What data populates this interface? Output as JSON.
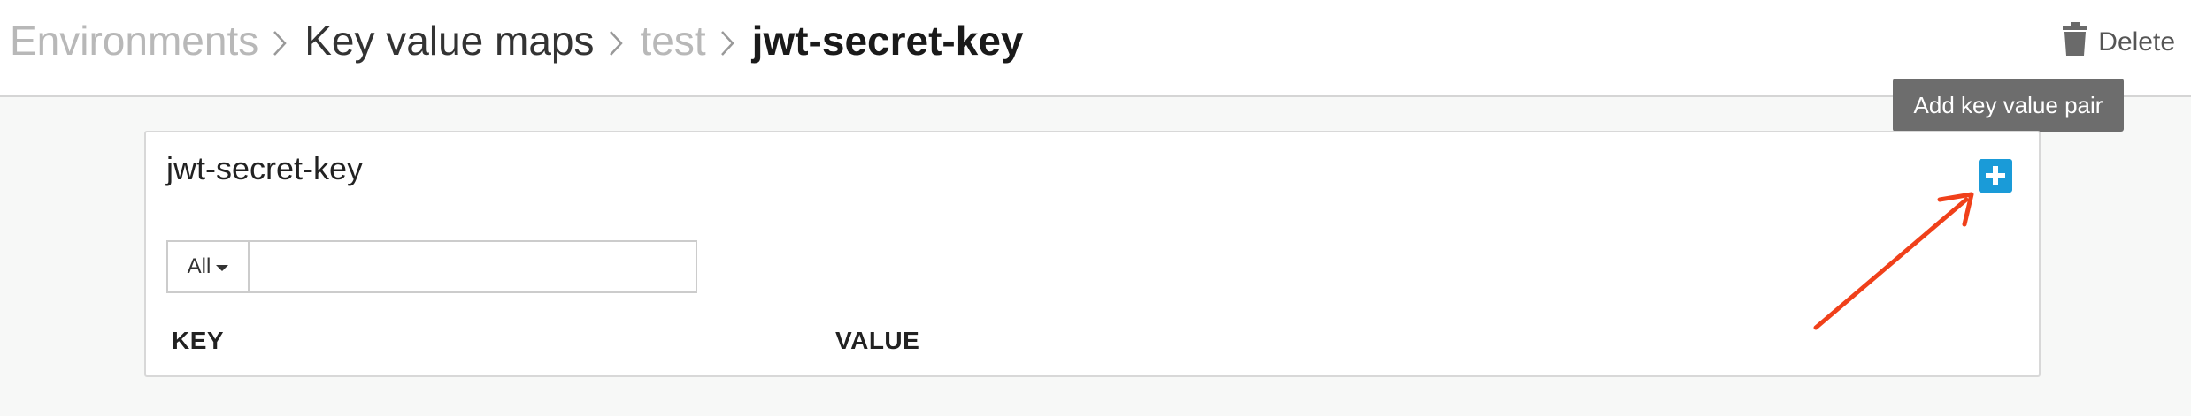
{
  "breadcrumb": {
    "items": [
      {
        "label": "Environments"
      },
      {
        "label": "Key value maps"
      },
      {
        "label": "test"
      },
      {
        "label": "jwt-secret-key"
      }
    ]
  },
  "header": {
    "delete_label": "Delete",
    "delete_icon": "trash-icon"
  },
  "tooltip": {
    "text": "Add key value pair"
  },
  "card": {
    "title": "jwt-secret-key",
    "add_icon": "plus-icon",
    "filter": {
      "selected": "All",
      "value": "",
      "placeholder": ""
    },
    "columns": [
      "KEY",
      "VALUE"
    ]
  },
  "colors": {
    "accent": "#1a9bd8",
    "annotation_arrow": "#f0401a",
    "tooltip_bg": "#6d6d6d"
  }
}
